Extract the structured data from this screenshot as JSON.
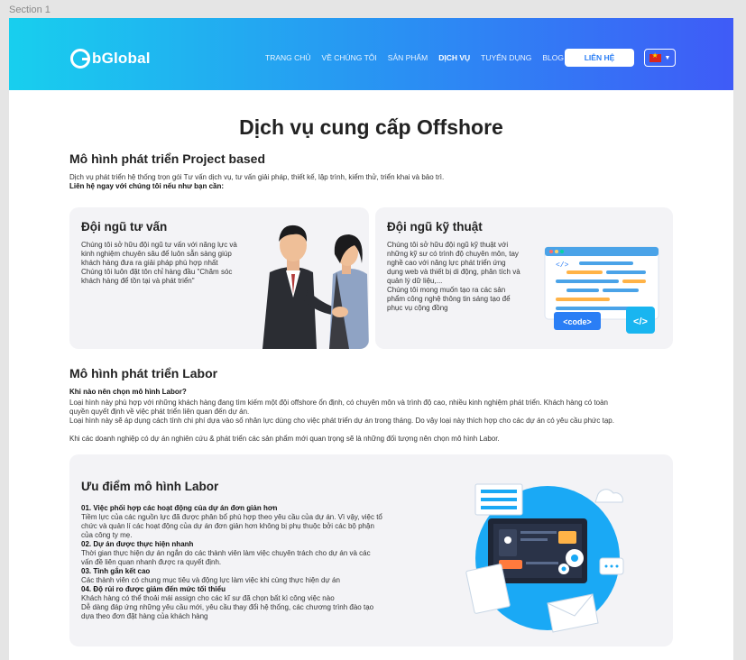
{
  "section_label": "Section 1",
  "header": {
    "logo_text": "bGlobal",
    "nav": [
      "TRANG CHỦ",
      "VỀ CHÚNG TÔI",
      "SẢN PHẨM",
      "DỊCH VỤ",
      "TUYỂN DỤNG",
      "BLOG"
    ],
    "active_nav": "DỊCH VỤ",
    "contact_label": "LIÊN HỆ",
    "language_icon": "vietnam-flag-icon",
    "colors": {
      "gradient_start": "#18cfee",
      "gradient_end": "#3f5bf7"
    }
  },
  "page_title": "Dịch vụ cung cấp Offshore",
  "project": {
    "title": "Mô hình phát triển Project based",
    "desc": "Dịch vụ phát triển hệ thống trọn gói Tư vấn dịch vụ, tư vấn giải pháp, thiết kế, lập trình, kiểm thử, triển khai và bảo trì.",
    "cta": "Liên hệ ngay với chúng tôi nếu như bạn cần:"
  },
  "cards": [
    {
      "title": "Đội ngũ tư vấn",
      "lines": [
        "Chúng tôi sở hữu đội ngũ tư vấn với năng lực và",
        "kinh nghiệm chuyên sâu để luôn sẵn sàng giúp",
        "khách hàng đưa ra giải pháp phù hợp nhất",
        "Chúng tôi luôn đặt tôn chỉ hàng đầu \"Chăm sóc",
        "khách hàng để tồn tại và phát triển\""
      ]
    },
    {
      "title": "Đội ngũ kỹ thuật",
      "lines": [
        "Chúng tôi sở hữu đội ngũ kỹ thuật với",
        "những kỹ sư có trình độ chuyên môn, tay",
        "nghề cao với năng lực phát triển ứng",
        "dụng web và thiết bị di động, phân tích và",
        "quản lý dữ liệu,...",
        "Chúng tôi mong muốn tạo ra các sản",
        "phẩm công nghệ thông tin sáng tạo để",
        "phục vụ cộng đồng"
      ],
      "code_tag": "<code>",
      "code_icon": "</>"
    }
  ],
  "labor": {
    "title": "Mô hình phát triển Labor",
    "question": "Khi nào nên chọn mô hình Labor?",
    "lines": [
      "Loại hình này phù hợp với những khách hàng đang tìm kiếm một đội offshore ổn định, có chuyên môn và trình độ cao, nhiều kinh nghiệm phát triển. Khách hàng có toàn",
      "quyền quyết định về việc phát triển liên quan đến dự án.",
      "Loại hình này sẽ áp dụng cách tính chi phí dựa vào số nhân lực dùng cho việc phát triển dự án trong tháng. Do vậy loại này thích hợp cho các dự án có yêu cầu phức tạp."
    ],
    "note": "Khi các doanh nghiệp có dự án nghiên cứu & phát triển các sản phẩm mới quan trọng sẽ là những đối tượng nên chọn mô hình Labor."
  },
  "advantages": {
    "title": "Ưu điểm mô hình Labor",
    "items": [
      {
        "title": "01. Việc phối hợp các hoạt động của dự án đơn giản hơn",
        "lines": [
          "Tiềm lực của các nguồn lực đã được phân bổ phù hợp theo yêu cầu của dự án. Vì vậy, việc tổ",
          "chức và quản lí các hoạt động của dự án đơn giản hơn không bị phụ thuộc bởi các bộ phận",
          "của công ty mẹ."
        ]
      },
      {
        "title": "02. Dự án được thực hiện nhanh",
        "lines": [
          "Thời gian thực hiện dự án ngắn do các thành viên làm việc chuyên trách cho dự án và các",
          "vấn đề liên quan nhanh được ra quyết định."
        ]
      },
      {
        "title": "03. Tinh gắn kết cao",
        "lines": [
          "Các thành viên có chung mục tiêu và động lực làm việc khi cùng thực hiện dự án"
        ]
      },
      {
        "title": "04. Độ rủi ro được giảm đến mức tối thiểu",
        "lines": [
          "Khách hàng có thể thoải mái assign cho các kĩ sư đã chọn bất kì công việc nào",
          "Dễ dàng đáp ứng những yêu cầu mới, yêu cầu thay đổi hệ thống, các chương trình đào tạo",
          "dựa theo đơn đặt hàng của khách hàng"
        ]
      }
    ]
  }
}
